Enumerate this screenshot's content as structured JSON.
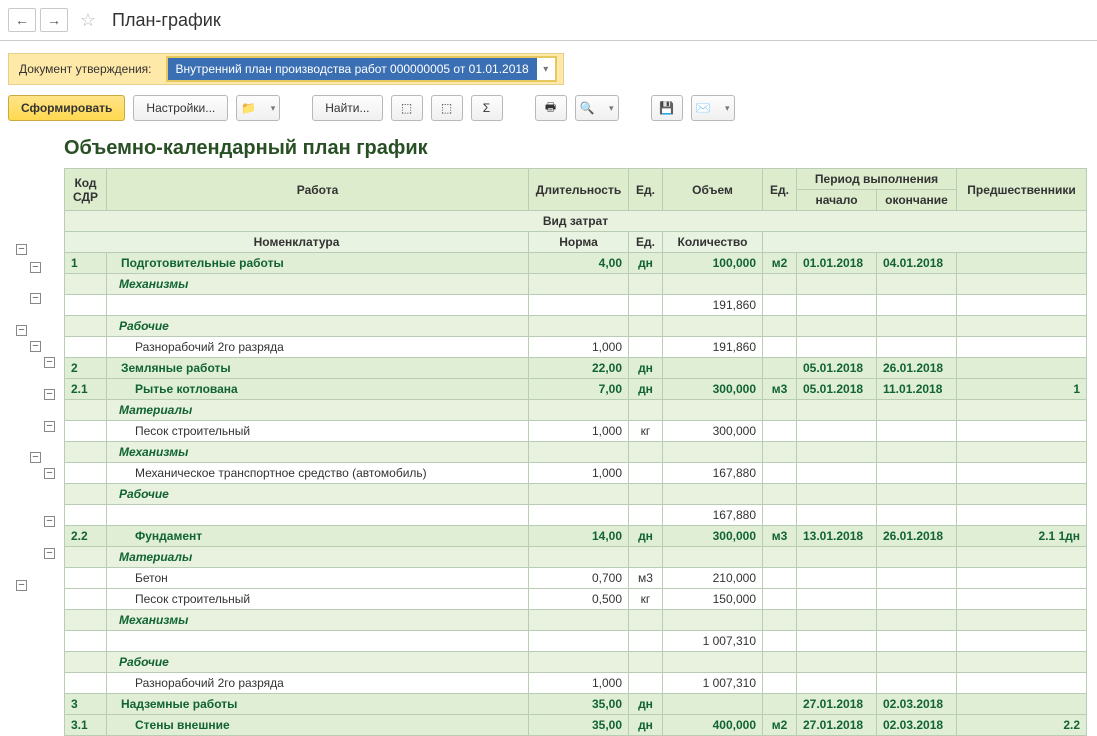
{
  "header": {
    "title": "План-график"
  },
  "approval": {
    "label": "Документ утверждения:",
    "value": "Внутренний план производства работ 000000005 от 01.01.2018"
  },
  "toolbar": {
    "form": "Сформировать",
    "settings": "Настройки...",
    "find": "Найти..."
  },
  "report": {
    "title": "Объемно-календарный план график",
    "headers": {
      "code": "Код СДР",
      "work": "Работа",
      "duration": "Длительность",
      "unit": "Ед.",
      "volume": "Объем",
      "unit2": "Ед.",
      "period": "Период выполнения",
      "start": "начало",
      "end": "окончание",
      "pred": "Предшественники",
      "cost_type": "Вид затрат",
      "nomenclature": "Номенклатура",
      "norm": "Норма",
      "unit3": "Ед.",
      "qty": "Количество"
    },
    "rows": [
      {
        "t": "group",
        "code": "1",
        "name": "Подготовительные работы",
        "dur": "4,00",
        "u": "дн",
        "vol": "100,000",
        "u2": "м2",
        "start": "01.01.2018",
        "end": "04.01.2018"
      },
      {
        "t": "cat",
        "name": "Механизмы"
      },
      {
        "t": "data",
        "name": "",
        "norm": "",
        "u": "",
        "qty": "191,860"
      },
      {
        "t": "cat",
        "name": "Рабочие"
      },
      {
        "t": "data",
        "name": "Разнорабочий 2го разряда",
        "norm": "1,000",
        "u": "",
        "qty": "191,860"
      },
      {
        "t": "group",
        "code": "2",
        "name": "Земляные работы",
        "dur": "22,00",
        "u": "дн",
        "start": "05.01.2018",
        "end": "26.01.2018"
      },
      {
        "t": "group",
        "code": "2.1",
        "name": "Рытье котлована",
        "dur": "7,00",
        "u": "дн",
        "vol": "300,000",
        "u2": "м3",
        "start": "05.01.2018",
        "end": "11.01.2018",
        "pred": "1"
      },
      {
        "t": "cat",
        "name": "Материалы"
      },
      {
        "t": "data",
        "name": "Песок строительный",
        "norm": "1,000",
        "u": "кг",
        "qty": "300,000"
      },
      {
        "t": "cat",
        "name": "Механизмы"
      },
      {
        "t": "data",
        "name": "Механическое транспортное средство (автомобиль)",
        "norm": "1,000",
        "u": "",
        "qty": "167,880"
      },
      {
        "t": "cat",
        "name": "Рабочие"
      },
      {
        "t": "data",
        "name": "",
        "norm": "",
        "u": "",
        "qty": "167,880"
      },
      {
        "t": "group",
        "code": "2.2",
        "name": "Фундамент",
        "dur": "14,00",
        "u": "дн",
        "vol": "300,000",
        "u2": "м3",
        "start": "13.01.2018",
        "end": "26.01.2018",
        "pred": "2.1  1дн"
      },
      {
        "t": "cat",
        "name": "Материалы"
      },
      {
        "t": "data",
        "name": "Бетон",
        "norm": "0,700",
        "u": "м3",
        "qty": "210,000"
      },
      {
        "t": "data",
        "name": "Песок строительный",
        "norm": "0,500",
        "u": "кг",
        "qty": "150,000"
      },
      {
        "t": "cat",
        "name": "Механизмы"
      },
      {
        "t": "data",
        "name": "",
        "norm": "",
        "u": "",
        "qty": "1 007,310"
      },
      {
        "t": "cat",
        "name": "Рабочие"
      },
      {
        "t": "data",
        "name": "Разнорабочий 2го разряда",
        "norm": "1,000",
        "u": "",
        "qty": "1 007,310"
      },
      {
        "t": "group",
        "code": "3",
        "name": "Надземные работы",
        "dur": "35,00",
        "u": "дн",
        "start": "27.01.2018",
        "end": "02.03.2018"
      },
      {
        "t": "group",
        "code": "3.1",
        "name": "Стены внешние",
        "dur": "35,00",
        "u": "дн",
        "vol": "400,000",
        "u2": "м2",
        "start": "27.01.2018",
        "end": "02.03.2018",
        "pred": "2.2"
      }
    ]
  }
}
